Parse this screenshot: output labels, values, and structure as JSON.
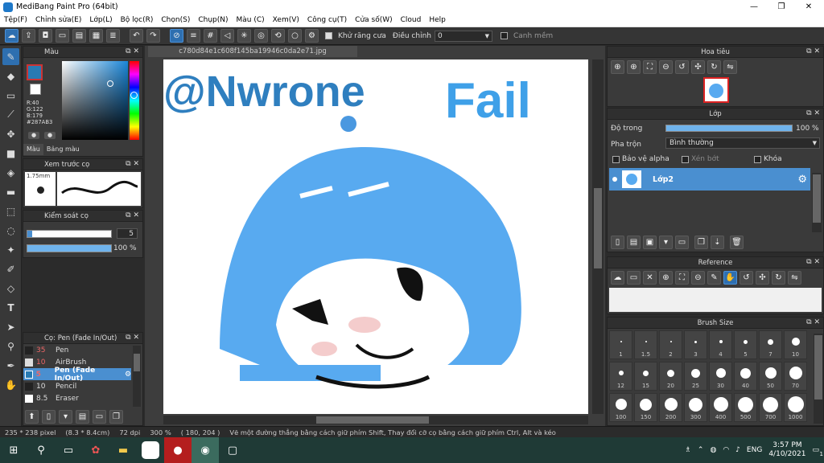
{
  "window": {
    "title": "MediBang Paint Pro (64bit)",
    "minimize": "—",
    "maximize": "❐",
    "close": "✕"
  },
  "menu": [
    "Tệp(F)",
    "Chỉnh sửa(E)",
    "Lớp(L)",
    "Bộ lọc(R)",
    "Chọn(S)",
    "Chụp(N)",
    "Màu (C)",
    "Xem(V)",
    "Công cụ(T)",
    "Cửa số(W)",
    "Cloud",
    "Help"
  ],
  "toolbar": {
    "antialias_label": "Khử răng cưa",
    "correction_label": "Điều chỉnh",
    "correction_value": "0",
    "edge_label": "Canh mềm"
  },
  "color_panel": {
    "title": "Màu",
    "r": "R:40",
    "g": "G:122",
    "b": "B:179",
    "hex": "#287AB3",
    "tab_color": "Màu",
    "tab_palette": "Bảng màu",
    "accent": "#287AB3"
  },
  "brush_preview": {
    "title": "Xem trước cọ",
    "size": "1.75mm"
  },
  "brush_control": {
    "title": "Kiểm soát cọ",
    "size_value": "5",
    "opacity_value": "100 %"
  },
  "brush_list": {
    "title": "Cọ: Pen (Fade In/Out)",
    "items": [
      {
        "size": "35",
        "name": "Pen"
      },
      {
        "size": "10",
        "name": "AirBrush"
      },
      {
        "size": "5",
        "name": "Pen (Fade In/Out)"
      },
      {
        "size": "10",
        "name": "Pencil"
      },
      {
        "size": "8.5",
        "name": "Eraser"
      }
    ]
  },
  "document": {
    "tab_name": "c780d84e1c608f145ba19946c0da2e71.jpg"
  },
  "navigator": {
    "title": "Hoa tiêu"
  },
  "layer_panel": {
    "title": "Lớp",
    "opacity_label": "Độ trong",
    "opacity_value": "100 %",
    "blend_label": "Pha trộn",
    "blend_value": "Bình thường",
    "protect_alpha": "Bảo vệ alpha",
    "clipping": "Xén bớt",
    "lock": "Khóa",
    "layer_name": "Lớp2"
  },
  "reference": {
    "title": "Reference"
  },
  "brush_size": {
    "title": "Brush Size",
    "sizes": [
      "1",
      "1.5",
      "2",
      "3",
      "4",
      "5",
      "7",
      "10",
      "12",
      "15",
      "20",
      "25",
      "30",
      "40",
      "50",
      "70",
      "100",
      "150",
      "200",
      "300",
      "400",
      "500",
      "700",
      "1000"
    ]
  },
  "status": {
    "size": "235 * 238 pixel",
    "physical": "(8.3 * 8.4cm)",
    "dpi": "72 dpi",
    "zoom": "300 %",
    "coords": "( 180, 204 )",
    "hint": "Vẽ một đường thẳng bằng cách giữ phím Shift, Thay đổi cỡ cọ bằng cách giữ phím Ctrl, Alt và kéo"
  },
  "tray": {
    "language": "ENG",
    "time": "3:57 PM",
    "date": "4/10/2021",
    "notifications": "1"
  },
  "drawing": {
    "text_left": "@Nwrone",
    "text_right": "Fail"
  }
}
